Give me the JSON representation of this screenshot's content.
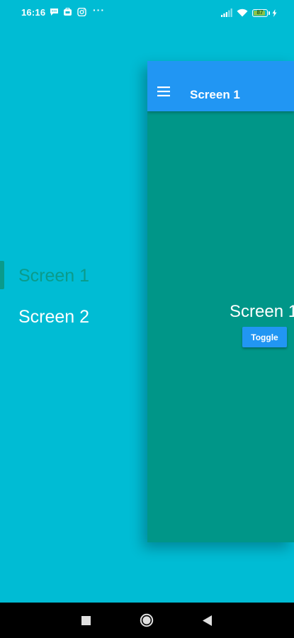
{
  "status_bar": {
    "time": "16:16",
    "more_indicator": "···",
    "battery_level": "87",
    "left_icons": [
      "message-icon",
      "store-icon",
      "instagram-icon"
    ],
    "right_icons": [
      "signal-icon",
      "wifi-icon",
      "battery-icon",
      "charging-icon"
    ]
  },
  "drawer": {
    "items": [
      {
        "label": "Screen 1",
        "active": true
      },
      {
        "label": "Screen 2",
        "active": false
      }
    ]
  },
  "screen": {
    "app_bar_title": "Screen 1",
    "body_text": "Screen 1",
    "toggle_label": "Toggle"
  },
  "nav_bar": {
    "buttons": [
      "recents-icon",
      "home-icon",
      "back-icon"
    ]
  },
  "colors": {
    "background": "#00BCD4",
    "app_bar": "#2196F3",
    "screen_bg": "#009688",
    "active_menu": "#0A9B8B",
    "button": "#2196F3"
  }
}
